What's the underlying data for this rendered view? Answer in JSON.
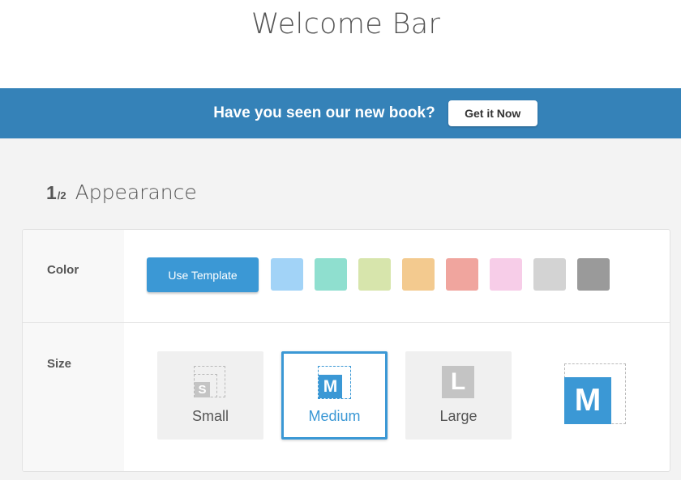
{
  "page": {
    "title": "Welcome Bar"
  },
  "welcome_bar": {
    "message": "Have you seen our new book?",
    "button_label": "Get it Now",
    "bg_color": "#3582b8"
  },
  "section": {
    "step_current": "1",
    "step_total": "/2",
    "name": "Appearance"
  },
  "color_row": {
    "label": "Color",
    "template_button_label": "Use Template",
    "swatches": [
      "#a2d3f7",
      "#8fdfcf",
      "#d7e5ac",
      "#f3ca8f",
      "#f0a59e",
      "#f7cde8",
      "#d3d3d3",
      "#9a9a9a"
    ]
  },
  "size_row": {
    "label": "Size",
    "options": [
      {
        "name": "Small",
        "icon_letter": "S"
      },
      {
        "name": "Medium",
        "icon_letter": "M"
      },
      {
        "name": "Large",
        "icon_letter": "L"
      }
    ],
    "selected": "Medium",
    "preview_letter": "M"
  },
  "colors": {
    "accent": "#3b98d5",
    "icon_gray": "#c4c4c4"
  }
}
